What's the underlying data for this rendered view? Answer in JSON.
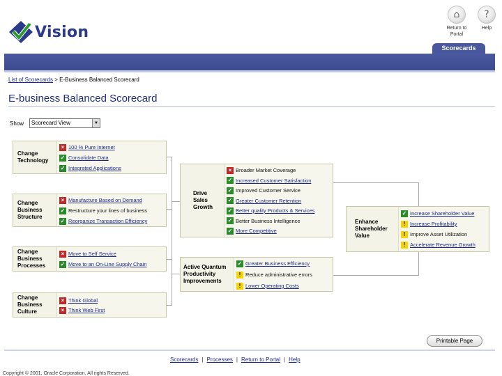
{
  "header": {
    "logo_text": "Vision",
    "return_label_1": "Return to",
    "return_label_2": "Portal",
    "help_label": "Help",
    "tab_label": "Scorecards"
  },
  "breadcrumb": {
    "link": "List of Scorecards",
    "separator": " > ",
    "current": "E-Business Balanced Scorecard"
  },
  "page_title": "E-business Balanced Scorecard",
  "show": {
    "label": "Show",
    "value": "Scorecard View"
  },
  "drivers": [
    {
      "label_lines": [
        "Change",
        "Technology"
      ],
      "items": [
        {
          "status": "red",
          "text": "100 % Pure Internet",
          "link": true
        },
        {
          "status": "green",
          "text": "Consolidate Data",
          "link": true
        },
        {
          "status": "green",
          "text": "Integrated Applications",
          "link": true
        }
      ]
    },
    {
      "label_lines": [
        "Change",
        "Business",
        "Structure"
      ],
      "items": [
        {
          "status": "red",
          "text": "Manufacture Based on Demand",
          "link": true
        },
        {
          "status": "green",
          "text": "Restructure your lines of business",
          "link": false
        },
        {
          "status": "green",
          "text": "Reorganize Transaction Efficiency",
          "link": true
        }
      ]
    },
    {
      "label_lines": [
        "Change",
        "Business",
        "Processes"
      ],
      "items": [
        {
          "status": "red",
          "text": "Move to Self Service",
          "link": true
        },
        {
          "status": "green",
          "text": "Move to an On-Line Supply Chain",
          "link": true
        }
      ]
    },
    {
      "label_lines": [
        "Change",
        "Business",
        "Culture"
      ],
      "items": [
        {
          "status": "red",
          "text": "Think Global",
          "link": true
        },
        {
          "status": "red",
          "text": "Think Web First",
          "link": true
        }
      ]
    }
  ],
  "middle": [
    {
      "label_lines": [
        "Drive",
        "Sales",
        "Growth"
      ],
      "items": [
        {
          "status": "red",
          "text": "Broader Market Coverage",
          "link": false
        },
        {
          "status": "green",
          "text": "Increased Customer Satisfaction",
          "link": true
        },
        {
          "status": "green",
          "text": "Improved Customer Service",
          "link": false
        },
        {
          "status": "green",
          "text": "Greater Customer Retention",
          "link": true
        },
        {
          "status": "green",
          "text": "Better quality Products & Services",
          "link": true
        },
        {
          "status": "green",
          "text": "Better Business Intelligence",
          "link": false
        },
        {
          "status": "green",
          "text": "More Competitive",
          "link": true
        }
      ]
    },
    {
      "label_lines": [
        "Active Quantum",
        "Productivity",
        "Improvements"
      ],
      "items": [
        {
          "status": "green",
          "text": "Greater Business Efficiency",
          "link": true
        },
        {
          "status": "yellow",
          "text": "Reduce administrative errors",
          "link": false
        },
        {
          "status": "yellow",
          "text": "Lower Operating Costs",
          "link": true
        }
      ]
    }
  ],
  "outcome": {
    "label_lines": [
      "Enhance",
      "Shareholder",
      "Value"
    ],
    "items": [
      {
        "status": "green",
        "text": "Increase Shareholder Value",
        "link": true
      },
      {
        "status": "yellow",
        "text": "Increase Profitability",
        "link": true
      },
      {
        "status": "yellow",
        "text": "Improve Asset Utilization",
        "link": false
      },
      {
        "status": "yellow",
        "text": "Accelerate Revenue Growth",
        "link": true
      }
    ]
  },
  "printable_button": "Printable Page",
  "footer": {
    "links": [
      "Scorecards",
      "Processes",
      "Return to Portal",
      "Help"
    ],
    "separator": "|",
    "copyright": "Copyright © 2001, Oracle Corporation. All rights Reserved."
  },
  "colors": {
    "brand_blue": "#49579d",
    "title_blue": "#1f2d7a",
    "status_red": "#c32828",
    "status_green": "#2a8b2a",
    "status_yellow": "#f5d400"
  }
}
